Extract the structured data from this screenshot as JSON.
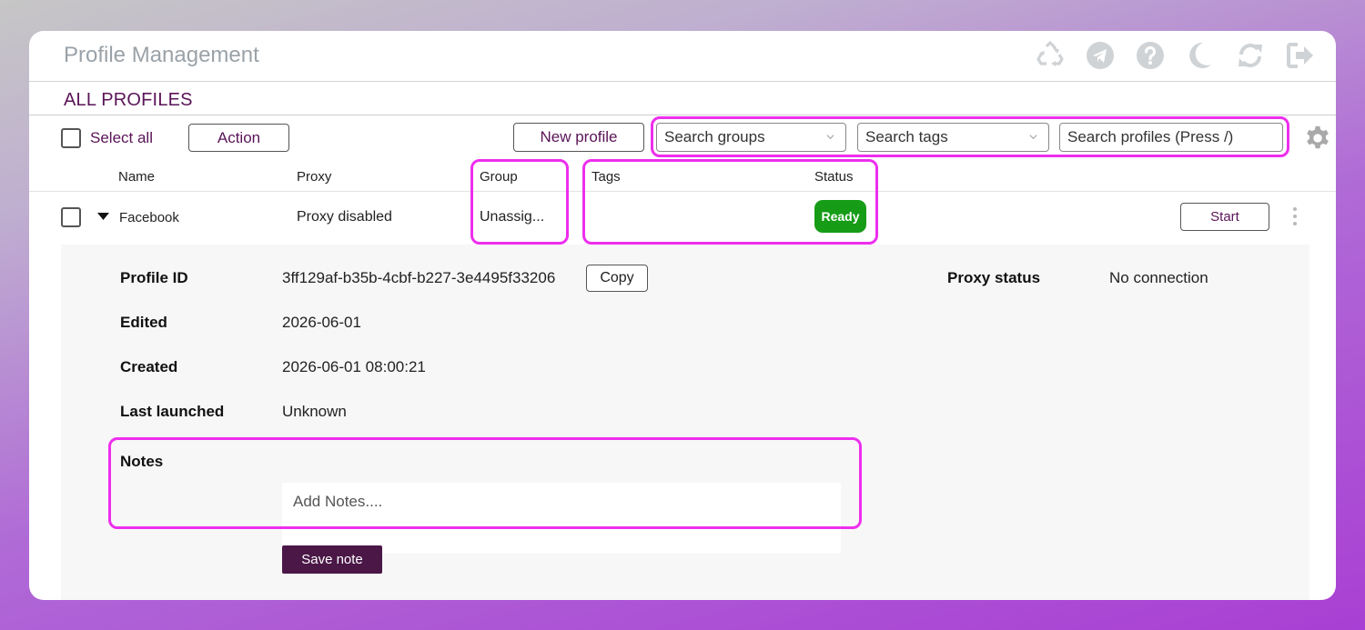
{
  "app": {
    "title": "Profile Management"
  },
  "header_icons": [
    "recycle-icon",
    "telegram-icon",
    "help-icon",
    "moon-icon",
    "refresh-icon",
    "logout-icon"
  ],
  "section": {
    "title": "ALL PROFILES"
  },
  "toolbar": {
    "select_all_label": "Select all",
    "action_label": "Action",
    "new_profile_label": "New profile",
    "search_groups_placeholder": "Search groups",
    "search_tags_placeholder": "Search tags",
    "search_profiles_placeholder": "Search profiles (Press /)"
  },
  "table": {
    "columns": [
      "Name",
      "Proxy",
      "Group",
      "Tags",
      "Status"
    ],
    "rows": [
      {
        "name": "Facebook",
        "proxy": "Proxy disabled",
        "group": "Unassig...",
        "tags": "",
        "status": "Ready",
        "start_label": "Start"
      }
    ]
  },
  "details": {
    "profile_id_label": "Profile ID",
    "profile_id": "3ff129af-b35b-4cbf-b227-3e4495f33206",
    "copy_label": "Copy",
    "proxy_status_label": "Proxy status",
    "proxy_status": "No connection",
    "edited_label": "Edited",
    "edited": "2026-06-01",
    "created_label": "Created",
    "created": "2026-06-01 08:00:21",
    "last_launched_label": "Last launched",
    "last_launched": "Unknown",
    "notes_label": "Notes",
    "notes_placeholder": "Add Notes....",
    "save_note_label": "Save note"
  },
  "colors": {
    "accent": "#5a1457",
    "status_ready": "#169c16",
    "highlight": "#ee2eee",
    "save_button": "#4a1747"
  }
}
